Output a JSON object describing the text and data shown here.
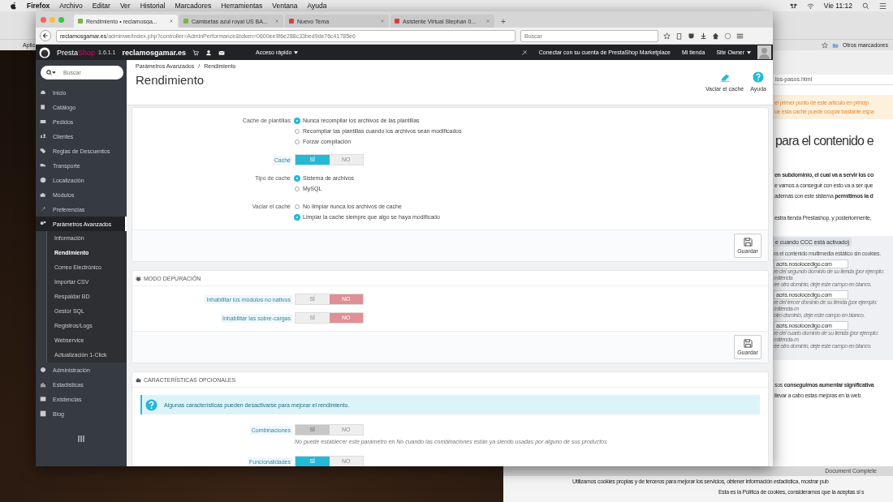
{
  "menubar": {
    "app": "Firefox",
    "menus": [
      "Archivo",
      "Editar",
      "Ver",
      "Historial",
      "Marcadores",
      "Herramientas",
      "Ventana",
      "Ayuda"
    ],
    "clock": "Vie 11:12"
  },
  "background_browser": {
    "bookmark_left": "Aplic",
    "bookmark_folder": "Otros marcadores",
    "url_fragment": "los-pasos.html",
    "notice": [
      "el primer punto de este artículo en princip",
      "ue esta caché puede ocupar bastante espa"
    ],
    "heading": "para el contenido e",
    "paragraph_top": [
      {
        "text": "en subdominio, el cual va a servir los co",
        "bold": true
      },
      {
        "text": "e vamos a conseguir con esto va a ser que",
        "bold": false
      },
      {
        "text": "además con este sistema **permitimos la d**",
        "bold": false
      }
    ],
    "paragraph_mid": "estra tienda Prestashop, y posteriormente,",
    "settings_box": {
      "tab": "e cuando CCC está activado)",
      "intro": "ra el contenido multimedia estático sin cookies.",
      "fields": [
        {
          "value": "acris.nosolocedigo.com",
          "help": [
            "re del segundo dominio de su tienda (por ejemplo: mitienda",
            "ee otro dominio, deje este campo en blanco."
          ]
        },
        {
          "value": "acris.nosolocedigo.com",
          "help": [
            "re del tercer dominio de su tienda (por ejemplo: mitienda-m",
            "otro dominio, deje este campo en blanco."
          ]
        },
        {
          "value": "acris.nosolocedigo.com",
          "help": [
            "re del cuarto dominio de su tienda (por ejemplo: mitienda-m",
            "ee otro dominio, deje este campo en blanco."
          ]
        }
      ]
    },
    "paragraph_bottom": [
      "sos **conseguimos aumentar significativa**",
      "llevar a cabo estas mejoras en la web."
    ],
    "status": "Document Complete",
    "cookie_notice": [
      "Utilizamos cookies propias y de terceros para mejorar los servicios, obtener información estadística, mostrar pub",
      "Esta es la Política de cookies, consideramos que la aceptas si s"
    ]
  },
  "browser": {
    "tabs": [
      {
        "title": "Rendimiento • reclamosga...",
        "selected": true
      },
      {
        "title": "Camisetas azul royal US BA...",
        "selected": false
      },
      {
        "title": "Nuevo Tema",
        "selected": false
      },
      {
        "title": "Asistente Virtual Stephan 0...",
        "selected": false
      }
    ],
    "new_tab": "+",
    "url_host": "reclamosgamar.es",
    "url_path": "/adminwe/index.php?controller=AdminPerformance&token=0600ee9f6e288c33bed9de76c41785e6",
    "search_placeholder": "Buscar"
  },
  "header": {
    "brand": [
      "Presta",
      "Shop"
    ],
    "version": "1.6.1.1",
    "shop": "reclamosgamar.es",
    "quick_access": "Acceso rápido",
    "marketplace": "Conectar con su cuenta de PrestaShop Marketplace",
    "my_shop": "Mi tienda",
    "user": "Site Owner"
  },
  "sidebar": {
    "search_placeholder": "Buscar",
    "items": [
      {
        "label": "Inicio",
        "selected": false
      },
      {
        "label": "Catálogo",
        "selected": false
      },
      {
        "label": "Pedidos",
        "selected": false
      },
      {
        "label": "Clientes",
        "selected": false
      },
      {
        "label": "Reglas de Descuentos",
        "selected": false
      },
      {
        "label": "Transporte",
        "selected": false
      },
      {
        "label": "Localización",
        "selected": false
      },
      {
        "label": "Módulos",
        "selected": false
      },
      {
        "label": "Preferencias",
        "selected": false
      },
      {
        "label": "Parámetros Avanzados",
        "selected": true,
        "children": [
          {
            "label": "Información",
            "selected": false
          },
          {
            "label": "Rendimiento",
            "selected": true
          },
          {
            "label": "Correo Electrónico",
            "selected": false
          },
          {
            "label": "Importar CSV",
            "selected": false
          },
          {
            "label": "Respaldar BD",
            "selected": false
          },
          {
            "label": "Gestor SQL",
            "selected": false
          },
          {
            "label": "Registros/Logs",
            "selected": false
          },
          {
            "label": "Webservice",
            "selected": false
          },
          {
            "label": "Actualización 1-Click",
            "selected": false
          }
        ]
      },
      {
        "label": "Administración",
        "selected": false
      },
      {
        "label": "Estadísticas",
        "selected": false
      },
      {
        "label": "Existencias",
        "selected": false
      },
      {
        "label": "Blog",
        "selected": false
      }
    ]
  },
  "page": {
    "breadcrumb": [
      "Parámetros Avanzados",
      "Rendimiento"
    ],
    "breadcrumb_separator": "/",
    "title": "Rendimiento",
    "toolbar": [
      {
        "label": "Vaciar el caché",
        "kind": "eraser"
      },
      {
        "label": "Ayuda",
        "kind": "help"
      }
    ]
  },
  "panels": [
    {
      "rows": [
        {
          "label": "Cache de plantillas",
          "help": false,
          "kind": "radio",
          "options": [
            {
              "label": "Nunca recompilar los archivos de las plantillas",
              "selected": true
            },
            {
              "label": "Recompilar las plantillas cuando los archivos sean modificados",
              "selected": false
            },
            {
              "label": "Forzar compilación",
              "selected": false
            }
          ]
        },
        {
          "label": "Caché",
          "help": true,
          "kind": "switch",
          "disabled": false,
          "options": [
            {
              "label": "SÍ",
              "selected": true
            },
            {
              "label": "NO",
              "selected": false
            }
          ]
        },
        {
          "label": "Tipo de cache",
          "help": false,
          "kind": "radio",
          "options": [
            {
              "label": "Sistema de archivos",
              "selected": true
            },
            {
              "label": "MySQL",
              "selected": false
            }
          ]
        },
        {
          "label": "Vaciar el caché",
          "help": false,
          "kind": "radio",
          "options": [
            {
              "label": "No limpiar nunca los archivos de cache",
              "selected": false
            },
            {
              "label": "Limpiar la cache siempre que algo se haya modificado",
              "selected": true
            }
          ]
        }
      ],
      "save": "Guardar"
    },
    {
      "heading": "MODO DEPURACIÓN",
      "rows": [
        {
          "label": "Inhabilitar los módulos no nativos",
          "help": true,
          "kind": "switch",
          "disabled": false,
          "options": [
            {
              "label": "SÍ",
              "selected": false
            },
            {
              "label": "NO",
              "selected": true
            }
          ]
        },
        {
          "label": "Inhabilitar las sobre-cargas",
          "help": true,
          "kind": "switch",
          "disabled": false,
          "options": [
            {
              "label": "SÍ",
              "selected": false
            },
            {
              "label": "NO",
              "selected": true
            }
          ]
        }
      ],
      "save": "Guardar"
    },
    {
      "heading": "CARACTERÍSTICAS OPCIONALES",
      "alert": "Algunas características pueden desactivarse para mejorar el rendimiento.",
      "rows": [
        {
          "label": "Combinaciones",
          "help": true,
          "kind": "switch",
          "disabled": true,
          "options": [
            {
              "label": "SÍ",
              "selected": true
            },
            {
              "label": "NO",
              "selected": false
            }
          ],
          "hint": "No puede establecer este parámetro en No cuando las combinaciones están ya siendo usadas por alguno de sus productos"
        },
        {
          "label": "Funcionalidades",
          "help": true,
          "kind": "switch",
          "disabled": false,
          "options": [
            {
              "label": "SÍ",
              "selected": true
            },
            {
              "label": "NO",
              "selected": false
            }
          ]
        }
      ]
    }
  ]
}
